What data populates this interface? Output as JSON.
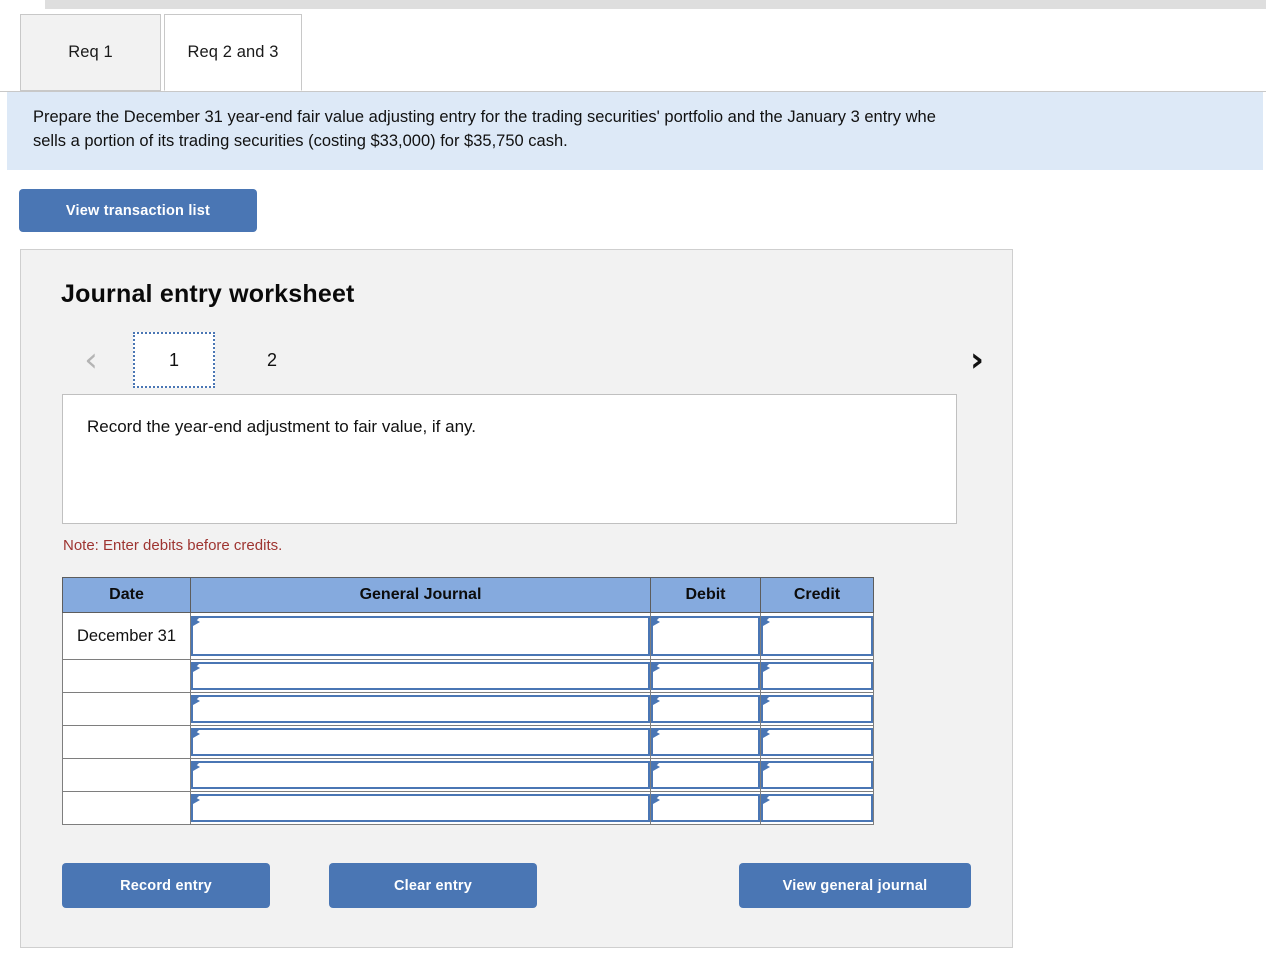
{
  "tabs": [
    {
      "label": "Req 1",
      "active": false
    },
    {
      "label": "Req 2 and 3",
      "active": true
    }
  ],
  "instruction": {
    "line1": "Prepare the December 31 year-end fair value adjusting entry for the trading securities' portfolio and the January 3 entry whe",
    "line2": "sells a portion of its trading securities (costing $33,000) for $35,750 cash."
  },
  "toolbar": {
    "view_transaction_list": "View transaction list"
  },
  "worksheet": {
    "title": "Journal entry worksheet",
    "pager": {
      "prev_icon": "‹",
      "next_icon": "›",
      "pages": [
        {
          "label": "1",
          "selected": true
        },
        {
          "label": "2",
          "selected": false
        }
      ]
    },
    "description": "Record the year-end adjustment to fair value, if any.",
    "note": "Note: Enter debits before credits.",
    "table": {
      "columns": [
        "Date",
        "General Journal",
        "Debit",
        "Credit"
      ],
      "rows": [
        {
          "date": "December 31",
          "general_journal": "",
          "debit": "",
          "credit": ""
        },
        {
          "date": "",
          "general_journal": "",
          "debit": "",
          "credit": ""
        },
        {
          "date": "",
          "general_journal": "",
          "debit": "",
          "credit": ""
        },
        {
          "date": "",
          "general_journal": "",
          "debit": "",
          "credit": ""
        },
        {
          "date": "",
          "general_journal": "",
          "debit": "",
          "credit": ""
        },
        {
          "date": "",
          "general_journal": "",
          "debit": "",
          "credit": ""
        }
      ]
    },
    "buttons": {
      "record_entry": "Record entry",
      "clear_entry": "Clear entry",
      "view_general_journal": "View general journal"
    }
  },
  "colors": {
    "button_blue": "#4a76b4",
    "header_blue": "#85aade",
    "banner_blue": "#dde9f7",
    "panel_gray": "#f2f2f2",
    "note_red": "#9e3430"
  }
}
